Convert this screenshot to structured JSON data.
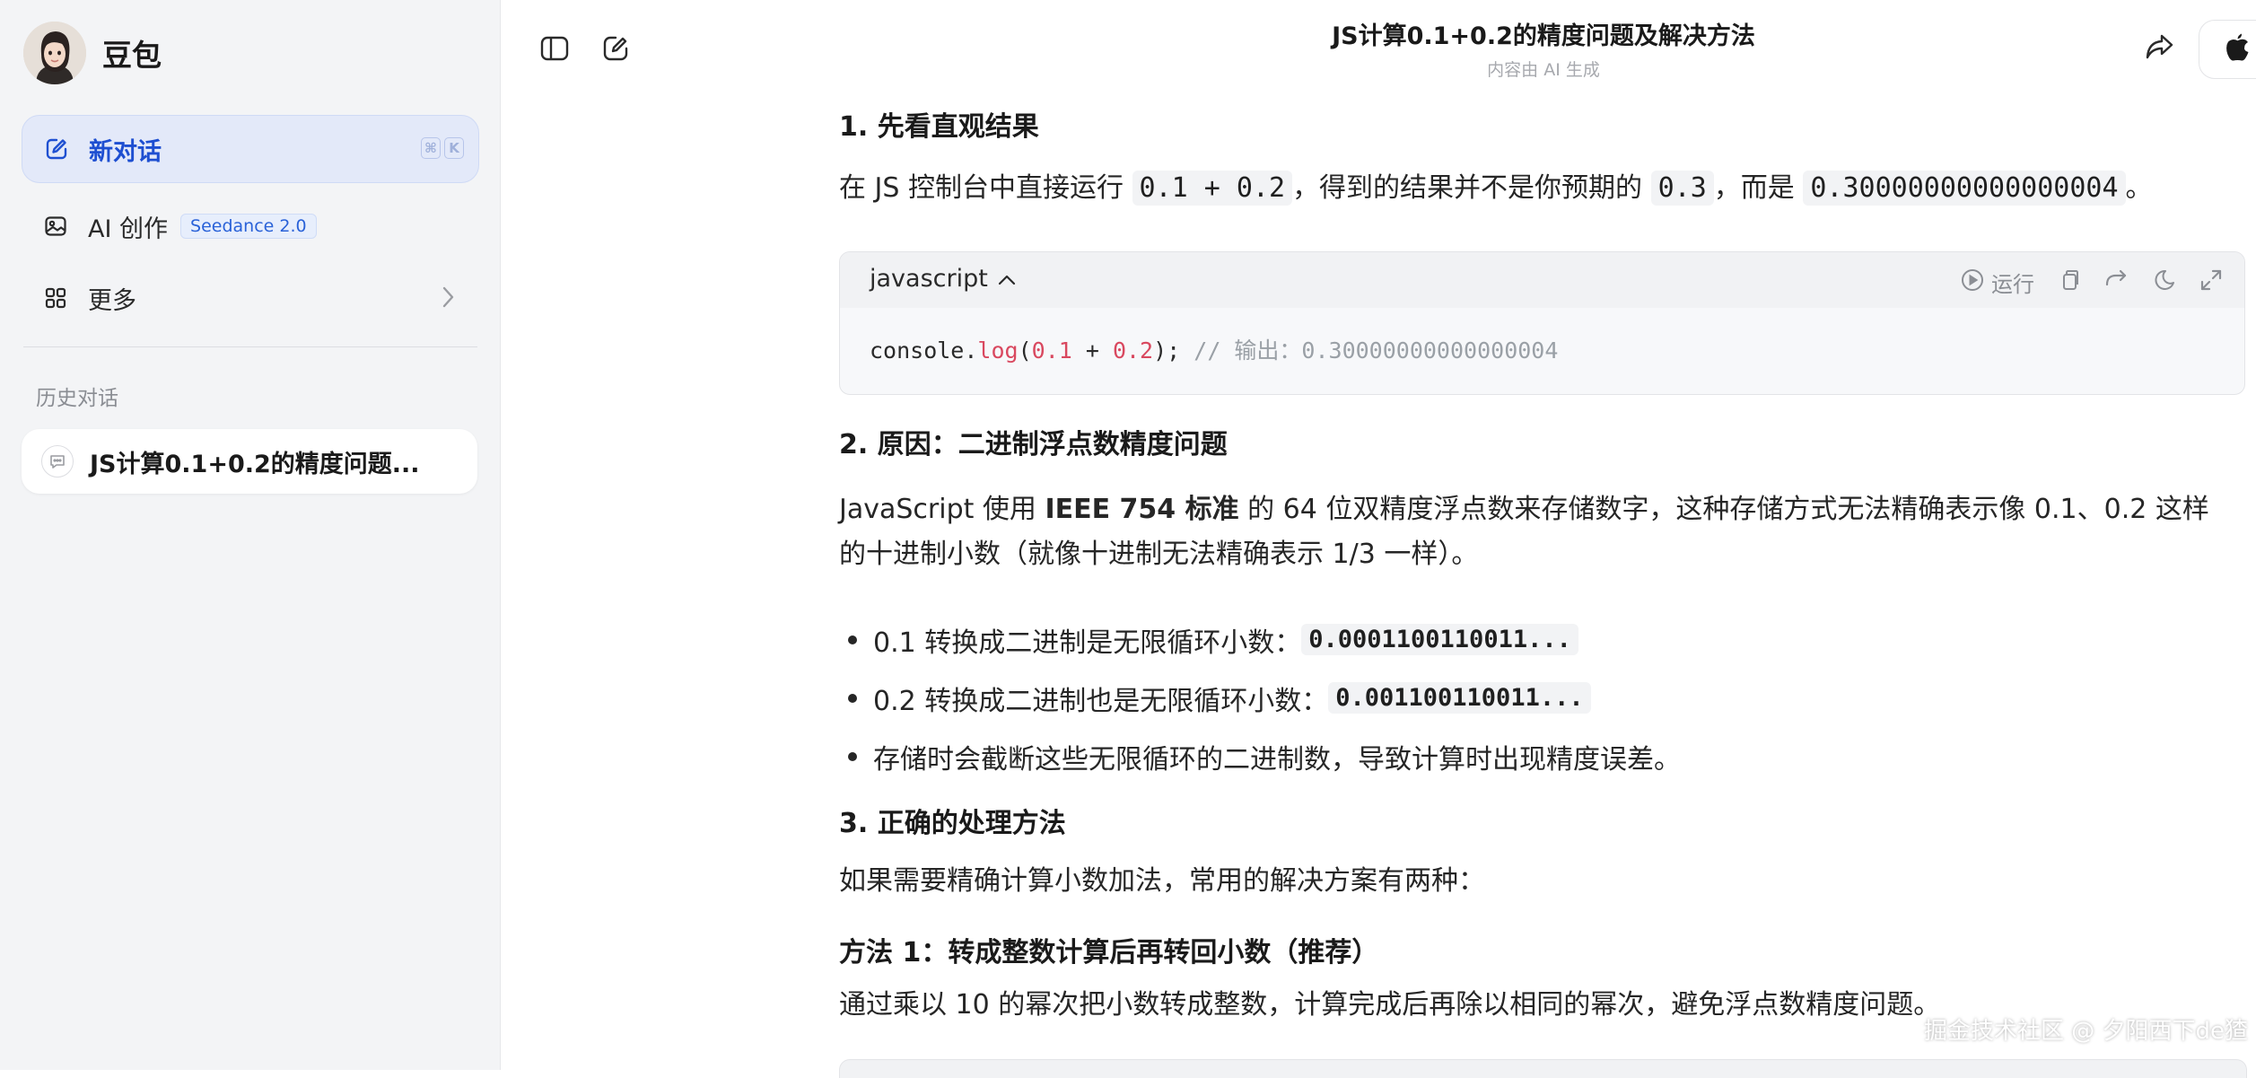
{
  "sidebar": {
    "brand_name": "豆包",
    "new_chat": {
      "label": "新对话",
      "shortcut": [
        "⌘",
        "K"
      ]
    },
    "ai_create": {
      "label": "AI 创作",
      "badge": "Seedance 2.0"
    },
    "more": {
      "label": "更多"
    },
    "history_label": "历史对话",
    "history_items": [
      {
        "label": "JS计算0.1+0.2的精度问题..."
      }
    ]
  },
  "header": {
    "title": "JS计算0.1+0.2的精度问题及解决方法",
    "subtitle": "内容由 AI 生成"
  },
  "content": {
    "h1": "1. 先看直观结果",
    "p1": {
      "pre": "在 JS 控制台中直接运行 ",
      "code1": "0.1 + 0.2",
      "mid1": "，得到的结果并不是你预期的 ",
      "code2": "0.3",
      "mid2": "，而是 ",
      "code3": "0.30000000000000004",
      "post": "。"
    },
    "codeblock": {
      "lang": "javascript",
      "run_label": "运行",
      "code": {
        "obj": "console",
        "dot": ".",
        "fn": "log",
        "open": "(",
        "n1": "0.1",
        "op": " + ",
        "n2": "0.2",
        "close": ");",
        "comment": " // 输出：0.30000000000000004"
      }
    },
    "h2": "2. 原因：二进制浮点数精度问题",
    "p2": {
      "line1_pre": "JavaScript 使用 ",
      "line1_bold": "IEEE 754 标准",
      "line1_post": " 的 64 位双精度浮点数来存储数字，这种存储方式无法精确表示像 0.1、0.2 这样",
      "line2": "的十进制小数（就像十进制无法精确表示 1/3 一样）。"
    },
    "bullets": [
      {
        "text": "0.1 转换成二进制是无限循环小数：",
        "code": "0.0001100110011..."
      },
      {
        "text": "0.2 转换成二进制也是无限循环小数：",
        "code": "0.001100110011..."
      },
      {
        "text": "存储时会截断这些无限循环的二进制数，导致计算时出现精度误差。",
        "code": ""
      }
    ],
    "h3": "3. 正确的处理方法",
    "p3": "如果需要精确计算小数加法，常用的解决方案有两种：",
    "h4": "方法 1：转成整数计算后再转回小数（推荐）",
    "p4": "通过乘以 10 的幂次把小数转成整数，计算完成后再除以相同的幂次，避免浮点数精度问题。"
  },
  "watermark": "掘金技术社区 @ 夕阳西下de猹",
  "colors": {
    "accent": "#1e4fd1",
    "code_fn": "#d9485f",
    "code_comment": "#9aa0a6"
  }
}
